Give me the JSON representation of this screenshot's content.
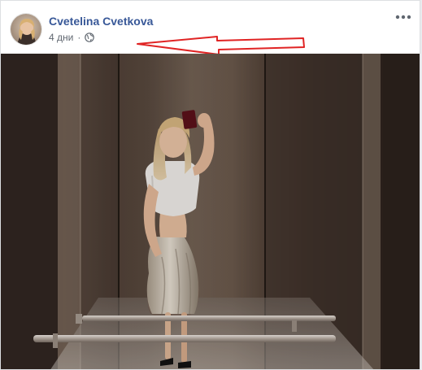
{
  "post": {
    "author_name": "Cvetelina Cvetkova",
    "timestamp": "4 дни",
    "privacy_icon": "globe-icon",
    "options_icon": "more-options-icon",
    "photo_alt": "",
    "annotation_color": "#e02424"
  }
}
